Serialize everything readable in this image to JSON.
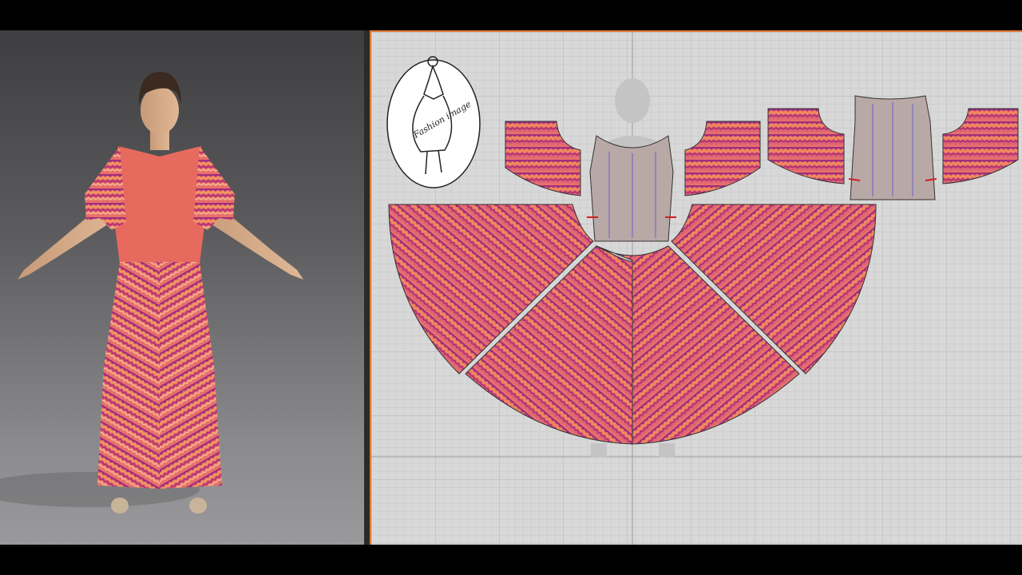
{
  "logo": {
    "text": "Fashion image"
  },
  "colors": {
    "fabric_magenta": "#9a2a7e",
    "fabric_coral": "#e8706a",
    "fabric_orange": "#f0905a",
    "fabric_pink": "#d8607a",
    "bodice": "#e66a5e",
    "pattern_panel": "#b8a8a6",
    "viewport_border": "#e07a30",
    "notch": "#d02020"
  },
  "icons": {
    "logo_icon": "woman-silhouette-oval-logo"
  }
}
